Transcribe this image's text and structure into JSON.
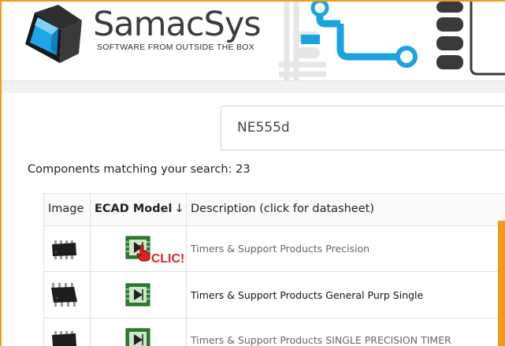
{
  "brand": {
    "name": "SamacSys",
    "tagline": "SOFTWARE FROM OUTSIDE THE BOX",
    "accent_color": "#f39a1b",
    "logo_icon": "cube-logo-icon",
    "pcb_color": "#1aa3e0"
  },
  "search": {
    "value": "NE555d"
  },
  "results": {
    "label": "Components matching your search: 23"
  },
  "table": {
    "headers": {
      "image": "Image",
      "ecad": "ECAD Model",
      "ecad_sort": "↓",
      "description": "Description (click for datasheet)"
    },
    "rows": [
      {
        "description": "Timers & Support Products Precision",
        "chip_icon": "soic-chip-icon",
        "ecad_icon": "ecad-model-icon"
      },
      {
        "description": "Timers & Support Products General Purp Single",
        "chip_icon": "soic-chip-icon",
        "ecad_icon": "ecad-model-icon"
      },
      {
        "description": "Timers & Support Products SINGLE PRECISION TIMER",
        "chip_icon": "soic-chip-icon",
        "ecad_icon": "ecad-model-icon"
      }
    ]
  },
  "annotation": {
    "text": "CLIC!",
    "color": "#e02020",
    "cursor_icon": "hand-pointer-icon"
  }
}
